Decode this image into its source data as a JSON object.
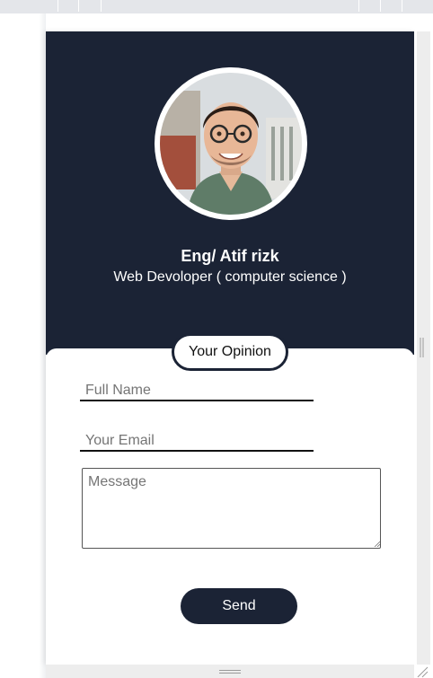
{
  "profile": {
    "name": "Eng/ Atif rizk",
    "role": "Web Devoloper ( computer science )",
    "avatar_alt": "profile photo"
  },
  "form": {
    "heading": "Your Opinion",
    "full_name_placeholder": "Full Name",
    "email_placeholder": "Your Email",
    "message_placeholder": "Message",
    "full_name_value": "",
    "email_value": "",
    "message_value": "",
    "send_label": "Send"
  },
  "colors": {
    "header_bg": "#1b2335",
    "button_bg": "#1b2335",
    "card_bg": "#ffffff",
    "text_light": "#ffffff"
  }
}
